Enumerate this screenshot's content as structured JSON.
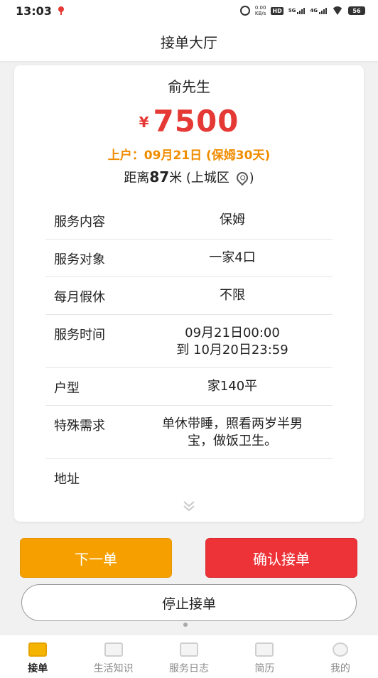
{
  "status_bar": {
    "time": "13:03",
    "net_speed_value": "0.00",
    "net_speed_unit": "KB/s",
    "hd_label": "HD",
    "signal_1_label": "5G",
    "signal_2_label": "4G",
    "battery_level": "56"
  },
  "header": {
    "title": "接单大厅"
  },
  "order": {
    "customer_name": "俞先生",
    "currency_symbol": "¥",
    "price": "7500",
    "start_info": "上户：09月21日 (保姆30天)",
    "distance_prefix": "距离",
    "distance_value": "87",
    "distance_unit_area": "米 (上城区",
    "distance_suffix": ")",
    "details": [
      {
        "label": "服务内容",
        "value": "保姆"
      },
      {
        "label": "服务对象",
        "value": "一家4口"
      },
      {
        "label": "每月假休",
        "value": "不限"
      },
      {
        "label": "服务时间",
        "value_line1": "09月21日00:00",
        "value_line2": "到 10月20日23:59"
      },
      {
        "label": "户型",
        "value": "家140平"
      },
      {
        "label": "特殊需求",
        "value_line1": "单休带睡，照看两岁半男",
        "value_line2": "宝，做饭卫生。"
      },
      {
        "label": "地址",
        "value": ""
      }
    ]
  },
  "actions": {
    "next_label": "下一单",
    "confirm_label": "确认接单",
    "stop_label": "停止接单"
  },
  "nav": {
    "items": [
      {
        "label": "接单",
        "icon": "order-icon",
        "active": true
      },
      {
        "label": "生活知识",
        "icon": "video-icon",
        "active": false
      },
      {
        "label": "服务日志",
        "icon": "calendar-icon",
        "active": false
      },
      {
        "label": "简历",
        "icon": "resume-icon",
        "active": false
      },
      {
        "label": "我的",
        "icon": "profile-icon",
        "active": false
      }
    ]
  },
  "colors": {
    "price": "#e53935",
    "start_info": "#f08c00",
    "next_button": "#f5a000",
    "confirm_button": "#ee3338",
    "nav_active": "#f5b400"
  }
}
